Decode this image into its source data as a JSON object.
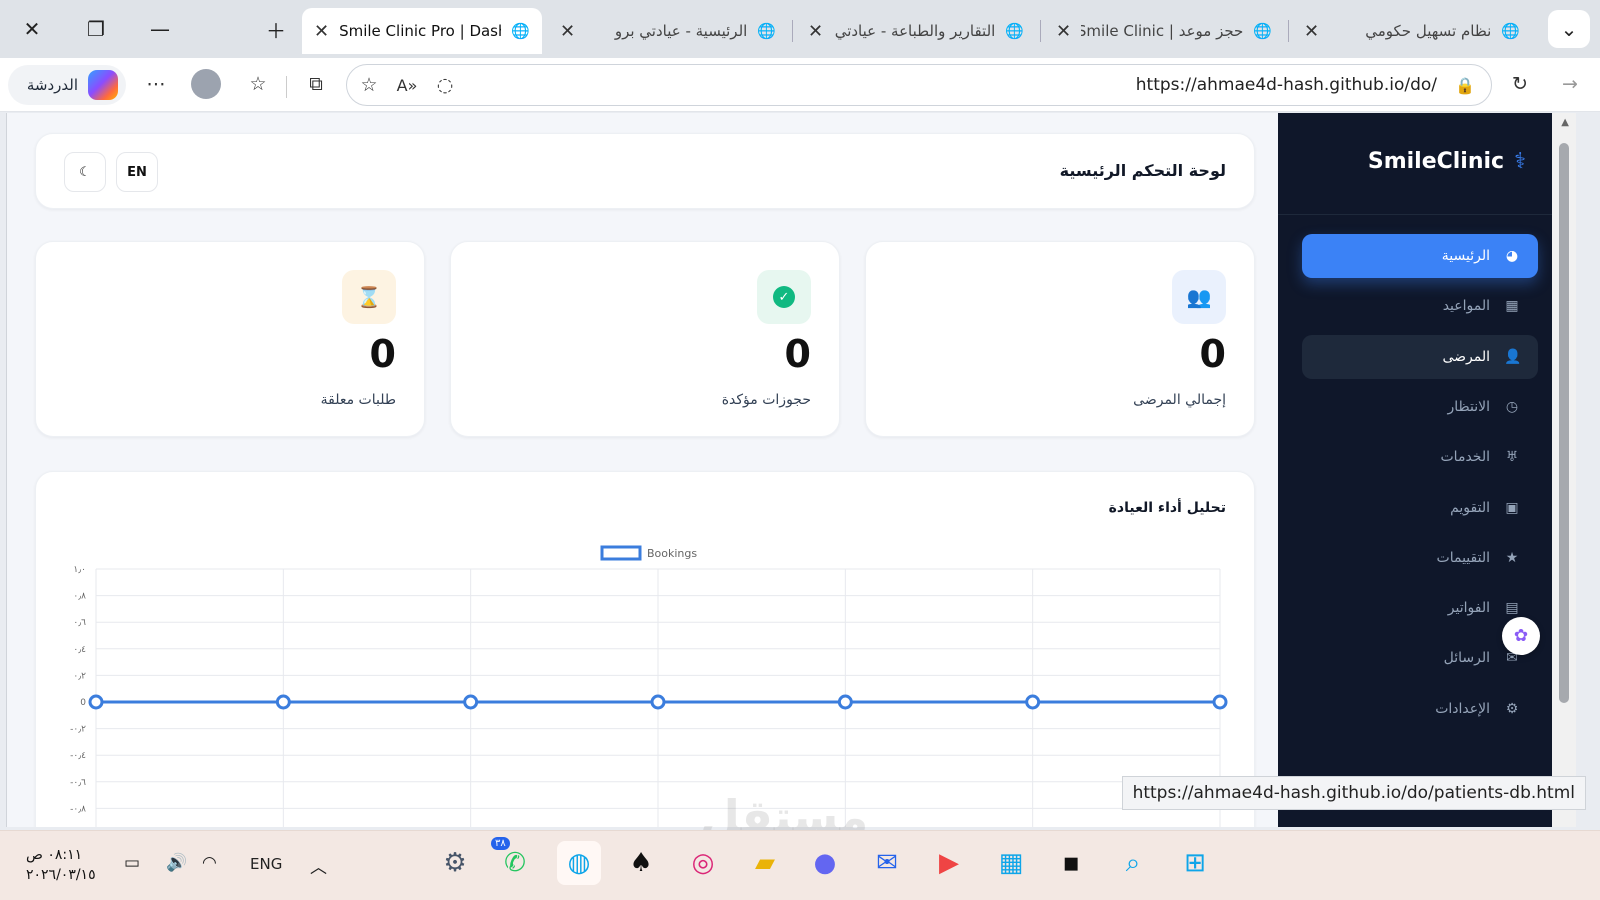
{
  "browser": {
    "tabs": [
      {
        "title": "نظام تسهيل حكومي",
        "active": false
      },
      {
        "title": "حجز موعد | Smile Clinic",
        "active": false
      },
      {
        "title": "التقارير والطباعة - عيادتي",
        "active": false
      },
      {
        "title": "الرئيسية - عيادتي برو",
        "active": false
      },
      {
        "title": "Smile Clinic Pro | Dashboard",
        "active": true
      }
    ],
    "copilot_label": "الدردشة",
    "url": "https://ahmae4d-hash.github.io/do/",
    "status_url": "https://ahmae4d-hash.github.io/do/patients-db.html"
  },
  "sidebar": {
    "brand": "SmileClinic",
    "items": [
      {
        "label": "الرئيسية",
        "icon": "pie-chart-icon",
        "state": "active"
      },
      {
        "label": "المواعيد",
        "icon": "calendar-icon",
        "state": ""
      },
      {
        "label": "المرضى",
        "icon": "user-icon",
        "state": "hover"
      },
      {
        "label": "الانتظار",
        "icon": "clock-icon",
        "state": ""
      },
      {
        "label": "الخدمات",
        "icon": "tooth-icon",
        "state": ""
      },
      {
        "label": "التقويم",
        "icon": "calendar-day-icon",
        "state": ""
      },
      {
        "label": "التقييمات",
        "icon": "star-icon",
        "state": ""
      },
      {
        "label": "الفواتير",
        "icon": "invoice-icon",
        "state": ""
      },
      {
        "label": "الرسائل",
        "icon": "envelope-icon",
        "state": ""
      },
      {
        "label": "الإعدادات",
        "icon": "gear-icon",
        "state": ""
      }
    ]
  },
  "header": {
    "title": "لوحة التحكم الرئيسية",
    "lang_button": "EN",
    "theme_icon": "moon-icon"
  },
  "stats": [
    {
      "label": "إجمالي المرضى",
      "value": "0",
      "icon": "users-icon",
      "color": "#3b82f6",
      "bg": "#eaf1fd"
    },
    {
      "label": "حجوزات مؤكدة",
      "value": "0",
      "icon": "check-circle-icon",
      "color": "#10b981",
      "bg": "#e7f7f0"
    },
    {
      "label": "طلبات معلقة",
      "value": "0",
      "icon": "hourglass-icon",
      "color": "#f59e0b",
      "bg": "#fdf3e2"
    }
  ],
  "chart_card": {
    "title": "تحليل أداء العيادة"
  },
  "chart_data": {
    "type": "line",
    "series": [
      {
        "name": "Bookings",
        "values": [
          0,
          0,
          0,
          0,
          0,
          0,
          0
        ],
        "color": "#3b7ddd"
      }
    ],
    "y_ticks": [
      "١٫٠",
      "٠٫٨",
      "٠٫٦",
      "٠٫٤",
      "٠٫٢",
      "0",
      "-٠٫٢",
      "-٠٫٤",
      "-٠٫٦",
      "-٠٫٨"
    ],
    "ylim": [
      -0.8,
      1.0
    ],
    "grid": true,
    "legend": "top-center"
  },
  "taskbar": {
    "time": "٠٨:١١ ص",
    "date": "٢٠٢٦/٠٣/١٥",
    "lang": "ENG",
    "whatsapp_badge": "٣٨"
  },
  "watermark": "مستقل"
}
